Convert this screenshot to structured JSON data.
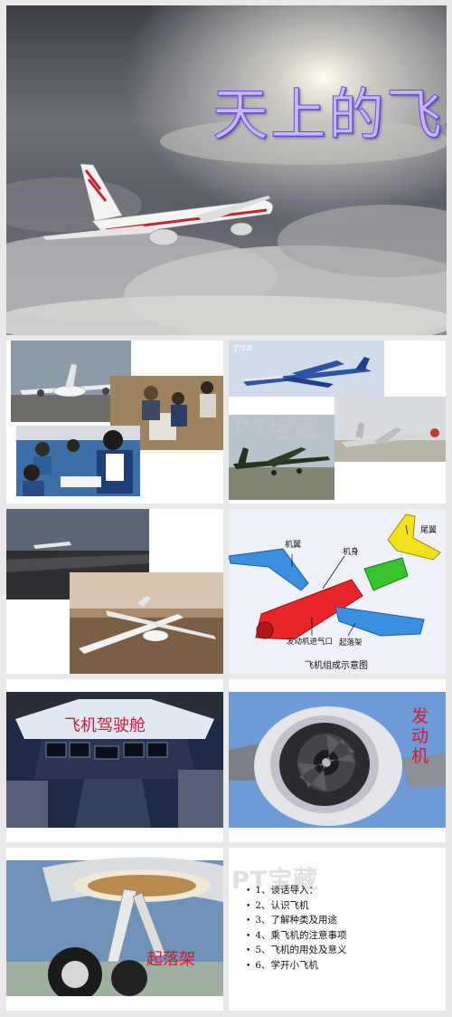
{
  "cover": {
    "title": "天上的飞机"
  },
  "slide_photos": {
    "tag": "J7EB",
    "watermark": "PT宝藏"
  },
  "slide_parts": {
    "labels": {
      "wing": "机翼",
      "fuselage": "机身",
      "tail": "尾翼",
      "intake": "发动机进气口",
      "gear": "起落架"
    },
    "caption": "飞机组成示意图"
  },
  "slide_cockpit": {
    "label": "飞机驾驶舱"
  },
  "slide_engine": {
    "label": "发动机"
  },
  "slide_gear": {
    "label": "起落架",
    "watermark": "PT宝藏",
    "outline": [
      "1、谈话导入：",
      "2、认识飞机",
      "3、了解种类及用途",
      "4、乘飞机的注意事项",
      "5、飞机的用处及意义",
      "6、学开小飞机"
    ]
  },
  "colors": {
    "title_fill": "#c9b6ff",
    "title_stroke": "#6b4fd6",
    "label_red": "#d8182a",
    "part_blue": "#3a8fe0",
    "part_red": "#e8262a",
    "part_green": "#37c52d",
    "part_yellow": "#f2e21c"
  }
}
